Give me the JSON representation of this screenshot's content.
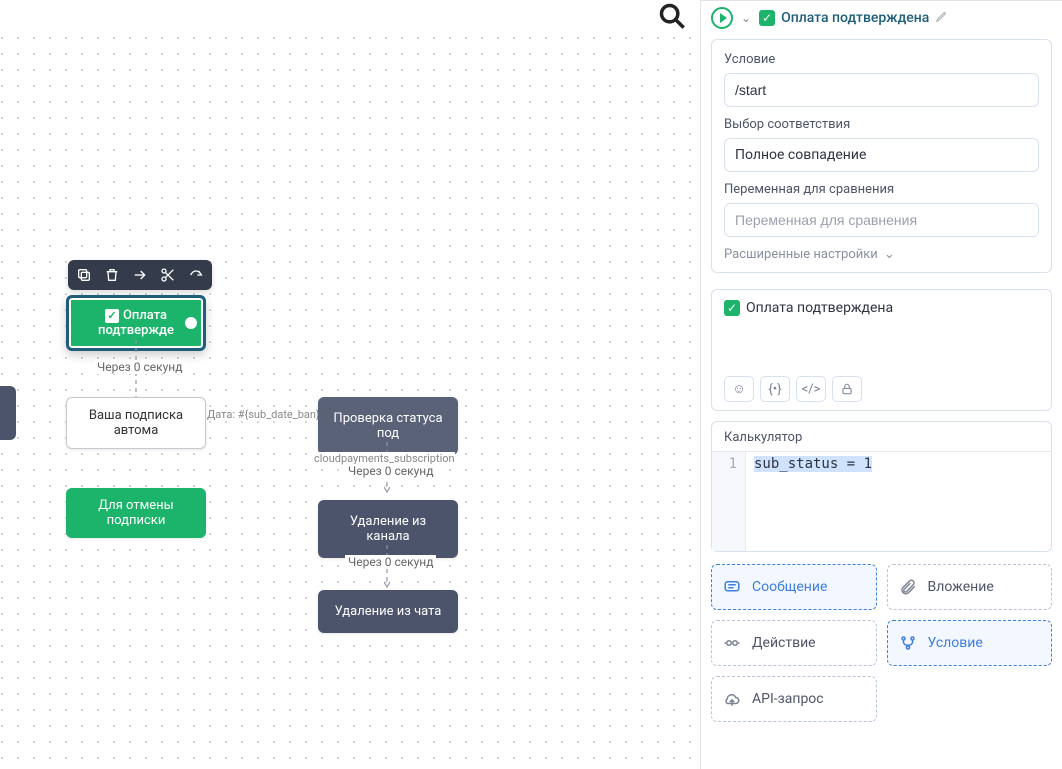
{
  "canvas": {
    "selected_node": "Оплата подтвержде",
    "edge_label_1": "Через 0 секунд",
    "node_subscription": "Ваша подписка автома",
    "annotation_date": "Дата: #{sub_date_ban}",
    "node_cancel": "Для отмены подписки",
    "node_check_status": "Проверка статуса под",
    "annotation_cp": "cloudpayments_subscription",
    "edge_label_2": "Через 0 секунд",
    "node_remove_channel": "Удаление из канала",
    "edge_label_3": "Через 0 секунд",
    "node_remove_chat": "Удаление из чата"
  },
  "panel": {
    "title": "Оплата подтверждена",
    "condition_label": "Условие",
    "condition_value": "/start",
    "match_label": "Выбор соответствия",
    "match_value": "Полное совпадение",
    "var_label": "Переменная для сравнения",
    "var_placeholder": "Переменная для сравнения",
    "advanced_label": "Расширенные настройки",
    "preview_text": "Оплата подтверждена",
    "calc_label": "Калькулятор",
    "code_line_no": "1",
    "code_line": "sub_status = 1"
  },
  "actions": {
    "message": "Сообщение",
    "attachment": "Вложение",
    "action": "Действие",
    "condition": "Условие",
    "api": "API-запрос"
  }
}
